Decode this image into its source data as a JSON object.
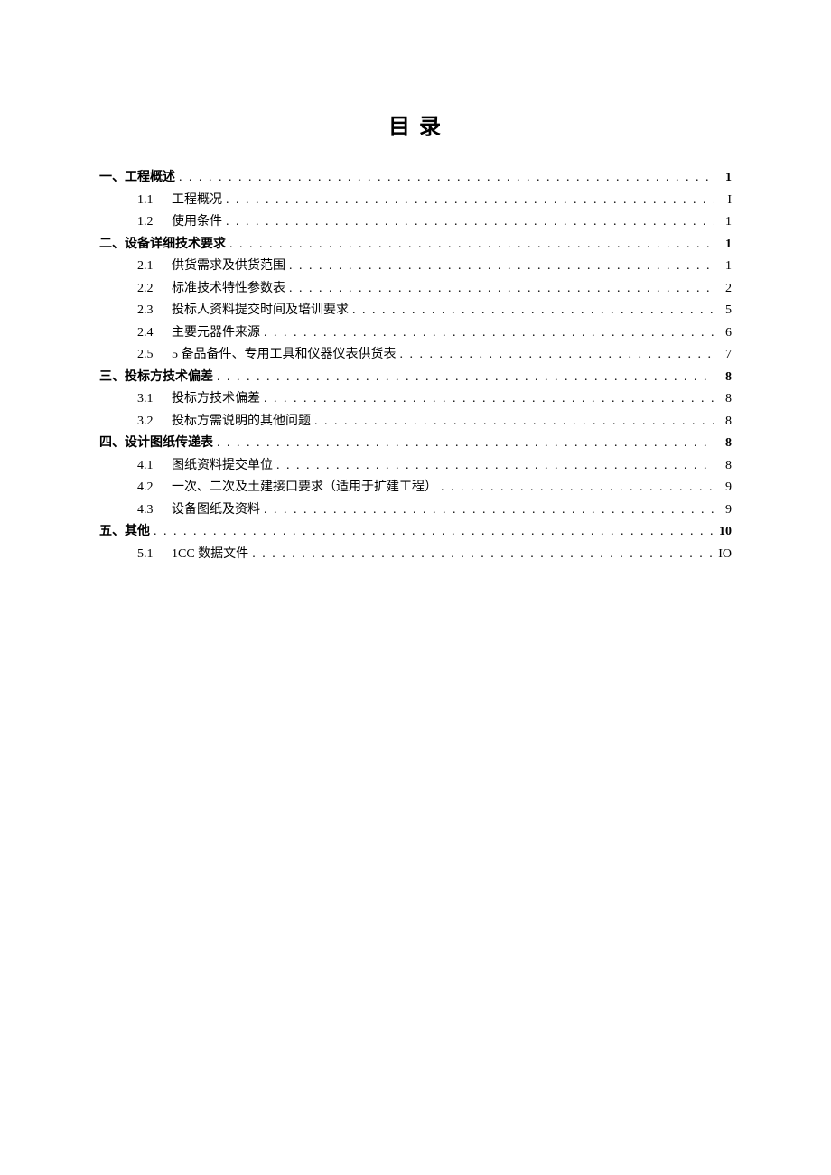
{
  "title": "目 录",
  "toc": [
    {
      "level": 1,
      "marker": "一、",
      "title": "工程概述",
      "page": "1"
    },
    {
      "level": 2,
      "marker": "1.1",
      "title": "工程概况",
      "page": "I"
    },
    {
      "level": 2,
      "marker": "1.2",
      "title": "使用条件",
      "page": "1"
    },
    {
      "level": 1,
      "marker": "二、",
      "title": "设备详细技术要求",
      "page": "1"
    },
    {
      "level": 2,
      "marker": "2.1",
      "title": "供货需求及供货范围",
      "page": "1"
    },
    {
      "level": 2,
      "marker": "2.2",
      "title": "标准技术特性参数表",
      "page": "2"
    },
    {
      "level": 2,
      "marker": "2.3",
      "title": "投标人资料提交时间及培训要求",
      "page": "5"
    },
    {
      "level": 2,
      "marker": "2.4",
      "title": "主要元器件来源",
      "page": "6"
    },
    {
      "level": 2,
      "marker": "2.5",
      "title": "5 备品备件、专用工具和仪器仪表供货表",
      "page": "7"
    },
    {
      "level": 1,
      "marker": "三、",
      "title": "投标方技术偏差",
      "page": "8"
    },
    {
      "level": 2,
      "marker": "3.1",
      "title": "投标方技术偏差",
      "page": "8"
    },
    {
      "level": 2,
      "marker": "3.2",
      "title": "投标方需说明的其他问题",
      "page": "8"
    },
    {
      "level": 1,
      "marker": "四、",
      "title": "设计图纸传递表",
      "page": "8"
    },
    {
      "level": 2,
      "marker": "4.1",
      "title": "图纸资料提交单位",
      "page": "8"
    },
    {
      "level": 2,
      "marker": "4.2",
      "title": "一次、二次及土建接口要求（适用于扩建工程）",
      "page": "9"
    },
    {
      "level": 2,
      "marker": "4.3",
      "title": "设备图纸及资料",
      "page": "9"
    },
    {
      "level": 1,
      "marker": "五、",
      "title": "其他",
      "page": "10"
    },
    {
      "level": 2,
      "marker": "5.1",
      "title": "1CC 数据文件",
      "page": "IO"
    }
  ],
  "dots": ". . . . . . . . . . . . . . . . . . . . . . . . . . . . . . . . . . . . . . . . . . . . . . . . . . . . . . . . . . . . . . . . . . . . . . . . . . . . . . . . . . . . . . . . . . . . . . . . . . . . . . . . . . . . . . . . . . . . . . . . . . . . . . . . . . . . . . . . . . . . . . . . . . . . . ."
}
